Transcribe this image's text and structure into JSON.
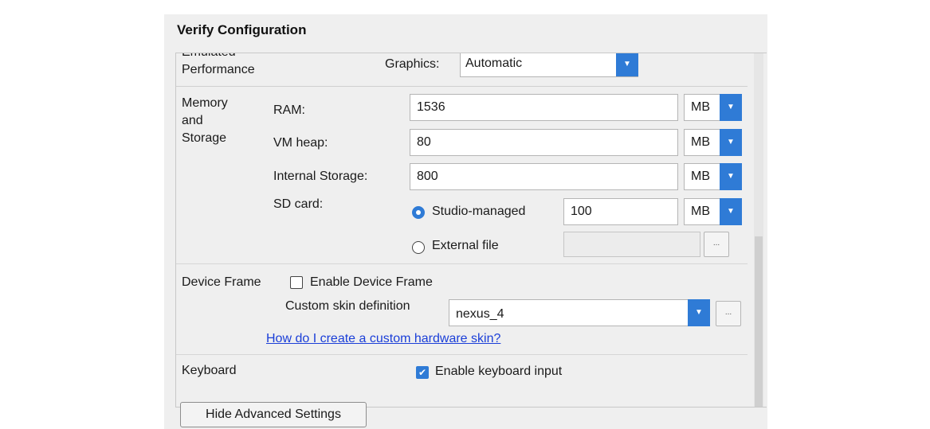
{
  "dialog": {
    "title": "Verify Configuration",
    "hide_button_label": "Hide Advanced Settings"
  },
  "emulated_performance": {
    "label_line1": "Emulated",
    "label_line2": "Performance",
    "graphics_label": "Graphics:",
    "graphics_value": "Automatic"
  },
  "memory": {
    "section_line1": "Memory",
    "section_line2": "and",
    "section_line3": "Storage",
    "ram_label": "RAM:",
    "ram_value": "1536",
    "ram_unit": "MB",
    "vmheap_label": "VM heap:",
    "vmheap_value": "80",
    "vmheap_unit": "MB",
    "internal_label": "Internal Storage:",
    "internal_value": "800",
    "internal_unit": "MB",
    "sdcard_label": "SD card:",
    "studio_managed_label": "Studio-managed",
    "studio_managed_selected": true,
    "sdcard_value": "100",
    "sdcard_unit": "MB",
    "external_file_label": "External file",
    "external_file_value": "",
    "browse_label": "..."
  },
  "device_frame": {
    "label": "Device Frame",
    "enable_label": "Enable Device Frame",
    "enabled": false,
    "skin_label": "Custom skin definition",
    "skin_value": "nexus_4",
    "skin_browse_label": "...",
    "help_link": "How do I create a custom hardware skin?"
  },
  "keyboard": {
    "label": "Keyboard",
    "enable_label": "Enable keyboard input",
    "enabled": true
  },
  "icons": {
    "dropdown_arrow": "▼",
    "checkmark": "✔"
  },
  "colors": {
    "accent": "#2f7bd6",
    "link": "#1a3ed8",
    "dialog_bg": "#efefef"
  }
}
